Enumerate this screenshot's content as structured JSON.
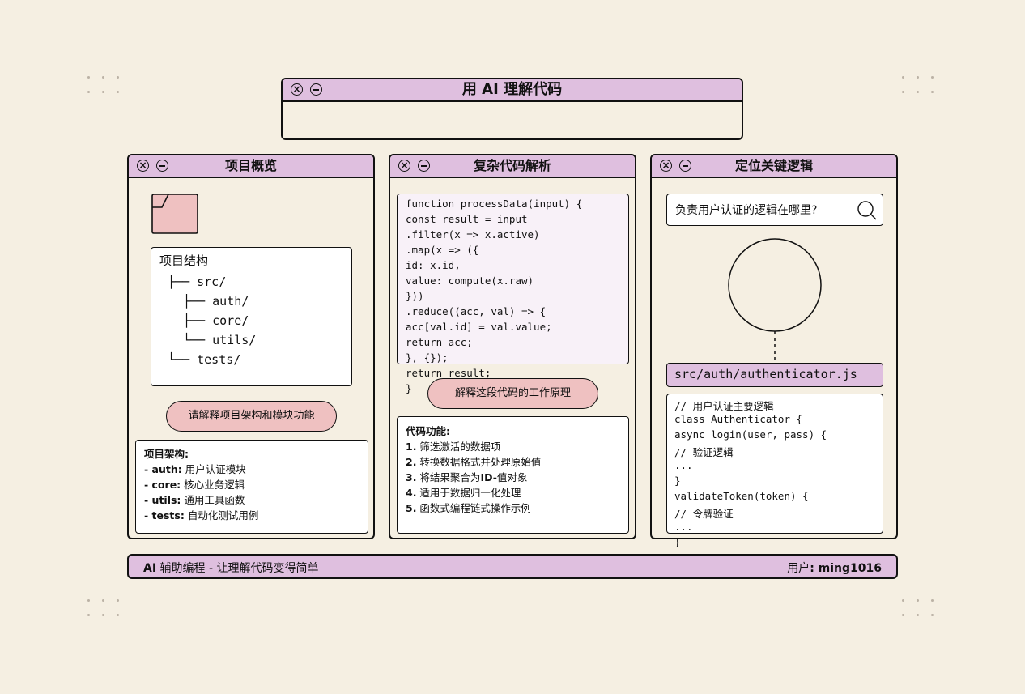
{
  "main_window": {
    "title": "用 AI 理解代码"
  },
  "panels": {
    "overview": {
      "title": "项目概览",
      "tree_title": "项目结构",
      "tree": [
        "├── src/",
        "├── auth/",
        "├── core/",
        "└── utils/",
        "└── tests/"
      ],
      "button": "请解释项目架构和模块功能",
      "answer_title": "项目架构:",
      "answer": [
        {
          "key": "- auth:",
          "text": " 用户认证模块"
        },
        {
          "key": "- core:",
          "text": " 核心业务逻辑"
        },
        {
          "key": "- utils:",
          "text": " 通用工具函数"
        },
        {
          "key": "- tests:",
          "text": " 自动化测试用例"
        }
      ]
    },
    "analysis": {
      "title": "复杂代码解析",
      "code": [
        "function processData(input) {",
        "const result = input",
        ".filter(x => x.active)",
        ".map(x => ({",
        "id: x.id,",
        "value: compute(x.raw)",
        "}))",
        ".reduce((acc, val) => {",
        "acc[val.id] = val.value;",
        "return acc;",
        "}, {});",
        "return result;",
        "}"
      ],
      "button": "解释这段代码的工作原理",
      "answer_title": "代码功能:",
      "answer": [
        {
          "key": "1.",
          "text": " 筛选激活的数据项"
        },
        {
          "key": "2.",
          "text": " 转换数据格式并处理原始值"
        },
        {
          "key": "3.",
          "text": " 将结果聚合为",
          "key2": "ID-",
          "text2": "值对象"
        },
        {
          "key": "4.",
          "text": " 适用于数据归一化处理"
        },
        {
          "key": "5.",
          "text": " 函数式编程链式操作示例"
        }
      ]
    },
    "locate": {
      "title": "定位关键逻辑",
      "search_value": "负责用户认证的逻辑在哪里?",
      "file_path": "src/auth/authenticator.js",
      "code": [
        "// 用户认证主要逻辑",
        "class Authenticator {",
        "async login(user, pass) {",
        "// 验证逻辑",
        "...",
        "}",
        "validateToken(token) {",
        "// 令牌验证",
        "...",
        "}"
      ]
    }
  },
  "footer": {
    "left_prefix": "AI",
    "left_text": " 辅助编程 - 让理解代码变得简单",
    "user_label": "用户",
    "user_name": ": ming1016"
  },
  "colors": {
    "background": "#f5efe2",
    "titlebar": "#dfbfdf",
    "button": "#efc1c1",
    "code_bg": "#f8f1f8"
  }
}
